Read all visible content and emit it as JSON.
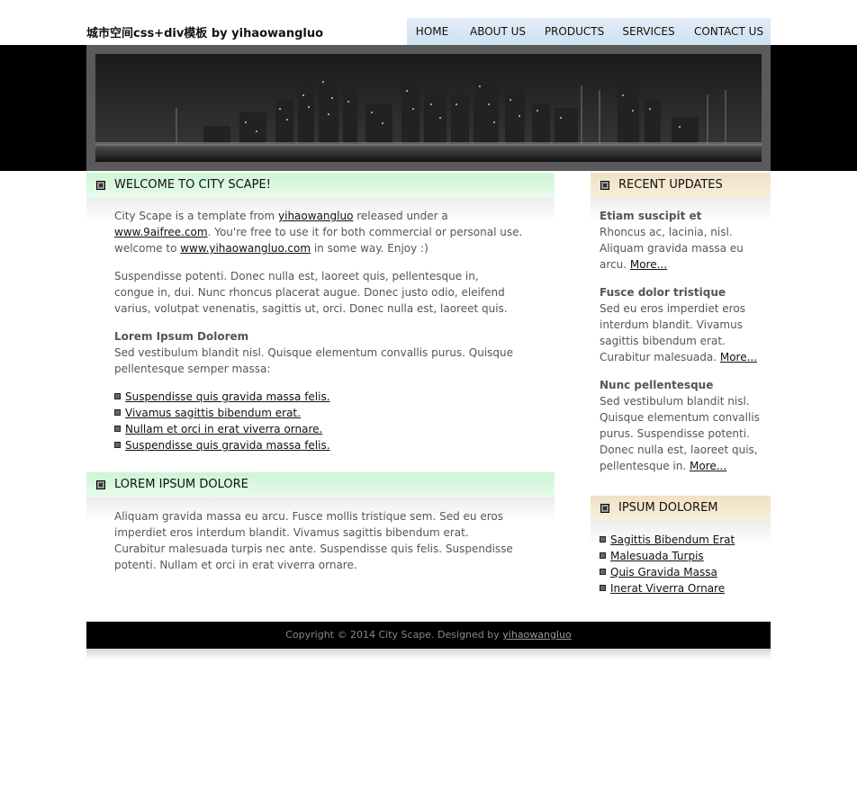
{
  "header": {
    "logo_text": "城市空间css+div模板 by yihaowangluo",
    "nav": [
      "HOME",
      "ABOUT US",
      "PRODUCTS",
      "SERVICES",
      "CONTACT US"
    ]
  },
  "welcome": {
    "title": "WELCOME TO CITY SCAPE!",
    "intro_pre": "City Scape is a template from ",
    "intro_link1": "yihaowangluo",
    "intro_mid": " released under a",
    "intro_link2": "www.9aifree.com",
    "intro_mid2": ". You're free to use it for both commercial or personal use.",
    "intro_mid3": "welcome to ",
    "intro_link3": "www.yihaowangluo.com",
    "intro_post": " in some way. Enjoy :)",
    "para2": "Suspendisse potenti. Donec nulla est, laoreet quis, pellentesque in, congue in, dui. Nunc rhoncus placerat augue. Donec justo odio, eleifend varius, volutpat venenatis, sagittis ut, orci. Donec nulla est, laoreet quis.",
    "subheading": "Lorem Ipsum Dolorem",
    "para3": "Sed vestibulum blandit nisl. Quisque elementum convallis purus. Quisque pellentesque semper massa:",
    "links": [
      "Suspendisse quis gravida massa felis.",
      "Vivamus sagittis bibendum erat.",
      "Nullam et orci in erat viverra ornare.",
      "Suspendisse quis gravida massa felis."
    ]
  },
  "lorem": {
    "title": "LOREM IPSUM DOLORE",
    "text": "Aliquam gravida massa eu arcu. Fusce mollis tristique sem. Sed eu eros imperdiet eros interdum blandit. Vivamus sagittis bibendum erat. Curabitur malesuada turpis nec ante. Suspendisse quis felis. Suspendisse potenti. Nullam et orci in erat viverra ornare."
  },
  "updates": {
    "title": "RECENT UPDATES",
    "more_label": "More...",
    "items": [
      {
        "heading": "Etiam suscipit et",
        "text": "Rhoncus ac, lacinia, nisl. Aliquam gravida massa eu arcu. "
      },
      {
        "heading": "Fusce dolor tristique",
        "text": "Sed eu eros imperdiet eros interdum blandit. Vivamus sagittis bibendum erat. Curabitur malesuada. "
      },
      {
        "heading": "Nunc pellentesque",
        "text": "Sed vestibulum blandit nisl. Quisque elementum convallis purus. Suspendisse potenti. Donec nulla est, laoreet quis, pellentesque in. "
      }
    ]
  },
  "ipsum": {
    "title": "IPSUM DOLOREM",
    "links": [
      "Sagittis Bibendum Erat",
      "Malesuada Turpis",
      "Quis Gravida Massa",
      "Inerat Viverra Ornare"
    ]
  },
  "footer": {
    "text": "Copyright © 2014 City Scape. Designed by ",
    "link": "yihaowangluo"
  }
}
